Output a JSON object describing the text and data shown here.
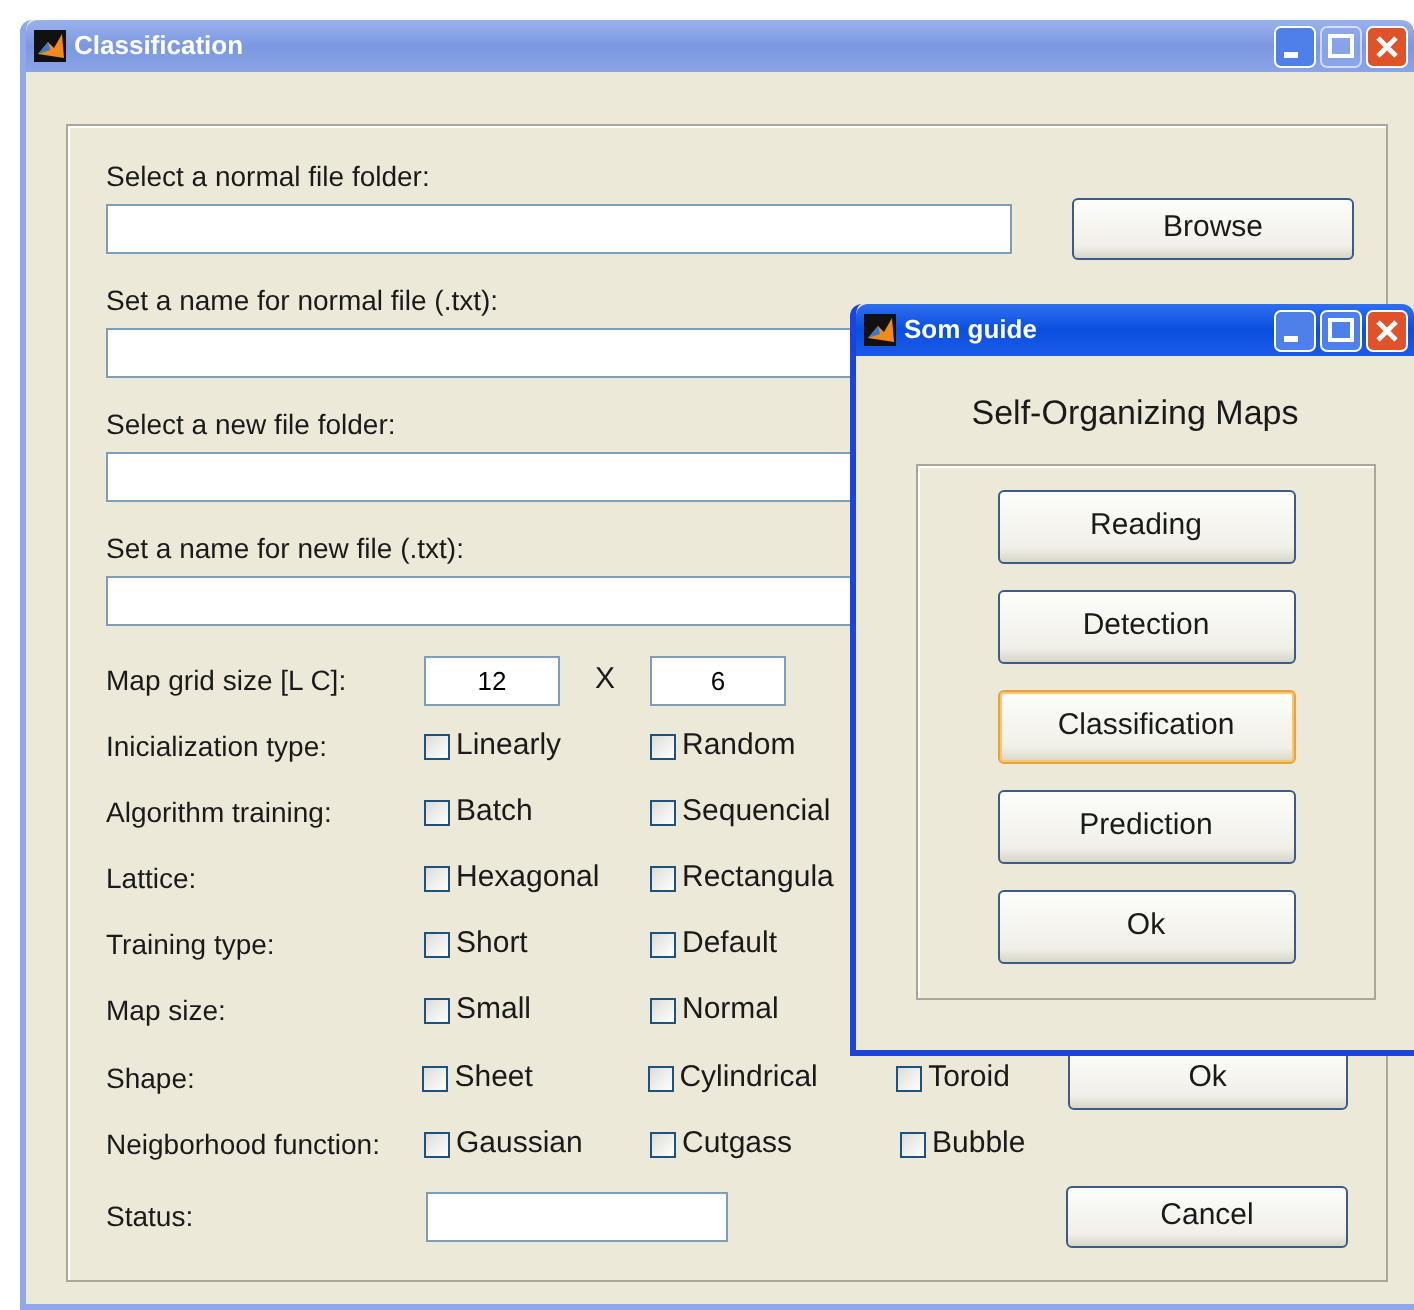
{
  "main_window": {
    "title": "Classification"
  },
  "file_fields": [
    {
      "label": "Select a normal file folder:",
      "button": "Browse"
    },
    {
      "label": "Set a name for normal file (.txt):"
    },
    {
      "label": "Select a new file folder:"
    },
    {
      "label": "Set a name for new file (.txt):"
    }
  ],
  "grid_size": {
    "label": "Map grid size [L C]:",
    "lines": "12",
    "separator": "X",
    "columns": "6"
  },
  "options": [
    {
      "label": "Inicialization type:",
      "choices": [
        {
          "text": "Linearly",
          "checked": false
        },
        {
          "text": "Random",
          "checked": false
        }
      ]
    },
    {
      "label": "Algorithm training:",
      "choices": [
        {
          "text": "Batch",
          "checked": false
        },
        {
          "text": "Sequencial",
          "checked": false
        }
      ]
    },
    {
      "label": "Lattice:",
      "choices": [
        {
          "text": "Hexagonal",
          "checked": false
        },
        {
          "text": "Rectangula",
          "checked": false
        }
      ]
    },
    {
      "label": "Training type:",
      "choices": [
        {
          "text": "Short",
          "checked": false
        },
        {
          "text": "Default",
          "checked": false
        }
      ]
    },
    {
      "label": "Map size:",
      "choices": [
        {
          "text": "Small",
          "checked": false
        },
        {
          "text": "Normal",
          "checked": false
        }
      ]
    },
    {
      "label": "Shape:",
      "choices": [
        {
          "text": "Sheet",
          "checked": false
        },
        {
          "text": "Cylindrical",
          "checked": false
        },
        {
          "text": "Toroid",
          "checked": false
        }
      ],
      "button": "Ok"
    },
    {
      "label": "Neigborhood function:",
      "choices": [
        {
          "text": "Gaussian",
          "checked": false
        },
        {
          "text": "Cutgass",
          "checked": false
        },
        {
          "text": "Bubble",
          "checked": false
        }
      ]
    }
  ],
  "status": {
    "label": "Status:",
    "button": "Cancel"
  },
  "dialog": {
    "title": "Som guide",
    "heading": "Self-Organizing Maps",
    "buttons": [
      {
        "label": "Reading",
        "focused": false
      },
      {
        "label": "Detection",
        "focused": false
      },
      {
        "label": "Classification",
        "focused": true
      },
      {
        "label": "Prediction",
        "focused": false
      },
      {
        "label": "Ok",
        "focused": false
      }
    ]
  }
}
